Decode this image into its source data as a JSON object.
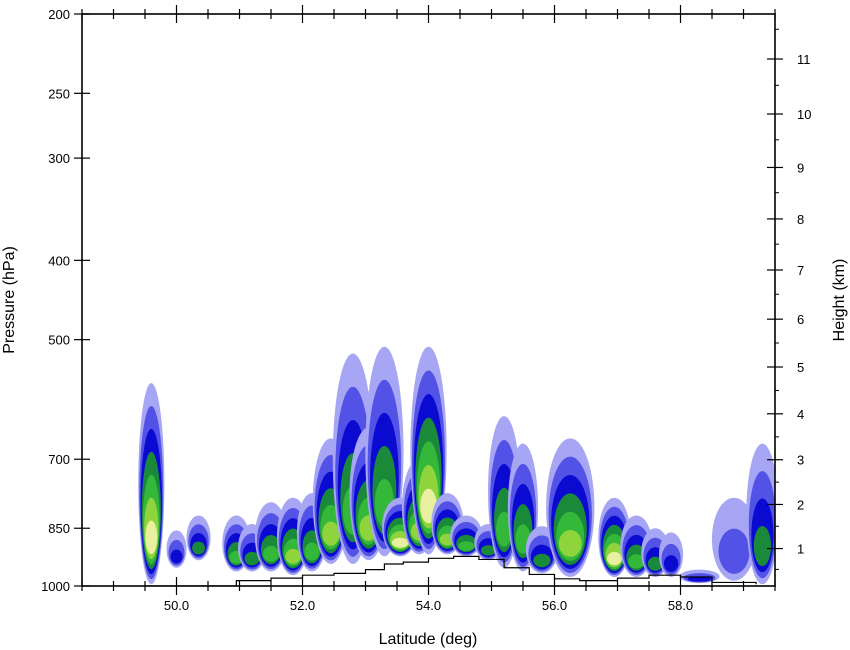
{
  "chart_data": {
    "type": "heatmap",
    "title": "",
    "xlabel": "Latitude (deg)",
    "ylabel_left": "Pressure (hPa)",
    "ylabel_right": "Height (km)",
    "xlim": [
      48.5,
      59.5
    ],
    "x_ticks": [
      {
        "value": 50,
        "label": "50.0"
      },
      {
        "value": 52,
        "label": "52.0"
      },
      {
        "value": 54,
        "label": "54.0"
      },
      {
        "value": 56,
        "label": "56.0"
      },
      {
        "value": 58,
        "label": "58.0"
      }
    ],
    "y_axis_left": {
      "scale": "log",
      "range": [
        1000,
        200
      ],
      "ticks": [
        {
          "value": 1000,
          "label": "1000"
        },
        {
          "value": 850,
          "label": "850"
        },
        {
          "value": 700,
          "label": "700"
        },
        {
          "value": 500,
          "label": "500"
        },
        {
          "value": 400,
          "label": "400"
        },
        {
          "value": 300,
          "label": "300"
        },
        {
          "value": 250,
          "label": "250"
        },
        {
          "value": 200,
          "label": "200"
        }
      ]
    },
    "y_axis_right": {
      "ticks": [
        {
          "value": 1,
          "label": "1",
          "pressure": 900
        },
        {
          "value": 2,
          "label": "2",
          "pressure": 795
        },
        {
          "value": 3,
          "label": "3",
          "pressure": 701
        },
        {
          "value": 4,
          "label": "4",
          "pressure": 616
        },
        {
          "value": 5,
          "label": "5",
          "pressure": 540
        },
        {
          "value": 6,
          "label": "6",
          "pressure": 472
        },
        {
          "value": 7,
          "label": "7",
          "pressure": 411
        },
        {
          "value": 8,
          "label": "8",
          "pressure": 356
        },
        {
          "value": 9,
          "label": "9",
          "pressure": 308
        },
        {
          "value": 10,
          "label": "10",
          "pressure": 265
        },
        {
          "value": 11,
          "label": "11",
          "pressure": 227
        }
      ]
    },
    "color_levels": [
      "#a6a6f4",
      "#5252e6",
      "#0a0ad0",
      "#1a8a3a",
      "#34b83a",
      "#8fd43c",
      "#e8f0a0"
    ],
    "terrain": [
      [
        49.5,
        1000
      ],
      [
        50.9,
        1000
      ],
      [
        50.95,
        985
      ],
      [
        51.5,
        978
      ],
      [
        52.0,
        970
      ],
      [
        52.5,
        965
      ],
      [
        53.0,
        955
      ],
      [
        53.3,
        940
      ],
      [
        53.6,
        935
      ],
      [
        54.0,
        925
      ],
      [
        54.4,
        920
      ],
      [
        54.8,
        928
      ],
      [
        55.2,
        950
      ],
      [
        55.6,
        968
      ],
      [
        56.0,
        980
      ],
      [
        56.4,
        985
      ],
      [
        57.0,
        978
      ],
      [
        57.5,
        970
      ],
      [
        58.0,
        975
      ],
      [
        58.5,
        990
      ],
      [
        59.2,
        995
      ]
    ],
    "cells": [
      {
        "lat": 49.6,
        "p_base": 995,
        "p_top": 565,
        "halfwidth": 0.09,
        "max_level": 6
      },
      {
        "lat": 50.0,
        "p_base": 950,
        "p_top": 855,
        "halfwidth": 0.06,
        "max_level": 2
      },
      {
        "lat": 50.35,
        "p_base": 930,
        "p_top": 820,
        "halfwidth": 0.08,
        "max_level": 3
      },
      {
        "lat": 50.95,
        "p_base": 960,
        "p_top": 820,
        "halfwidth": 0.1,
        "max_level": 4
      },
      {
        "lat": 51.2,
        "p_base": 960,
        "p_top": 840,
        "halfwidth": 0.1,
        "max_level": 3
      },
      {
        "lat": 51.5,
        "p_base": 960,
        "p_top": 790,
        "halfwidth": 0.12,
        "max_level": 4
      },
      {
        "lat": 51.85,
        "p_base": 970,
        "p_top": 780,
        "halfwidth": 0.12,
        "max_level": 5
      },
      {
        "lat": 52.15,
        "p_base": 960,
        "p_top": 770,
        "halfwidth": 0.11,
        "max_level": 4
      },
      {
        "lat": 52.45,
        "p_base": 940,
        "p_top": 660,
        "halfwidth": 0.14,
        "max_level": 5
      },
      {
        "lat": 52.8,
        "p_base": 940,
        "p_top": 520,
        "halfwidth": 0.16,
        "max_level": 4
      },
      {
        "lat": 53.05,
        "p_base": 930,
        "p_top": 640,
        "halfwidth": 0.15,
        "max_level": 5
      },
      {
        "lat": 53.3,
        "p_base": 920,
        "p_top": 510,
        "halfwidth": 0.15,
        "max_level": 4
      },
      {
        "lat": 53.55,
        "p_base": 920,
        "p_top": 780,
        "halfwidth": 0.14,
        "max_level": 6
      },
      {
        "lat": 53.85,
        "p_base": 915,
        "p_top": 700,
        "halfwidth": 0.13,
        "max_level": 5
      },
      {
        "lat": 54.0,
        "p_base": 915,
        "p_top": 510,
        "halfwidth": 0.14,
        "max_level": 6
      },
      {
        "lat": 54.3,
        "p_base": 915,
        "p_top": 770,
        "halfwidth": 0.12,
        "max_level": 5
      },
      {
        "lat": 54.6,
        "p_base": 920,
        "p_top": 820,
        "halfwidth": 0.12,
        "max_level": 4
      },
      {
        "lat": 54.95,
        "p_base": 930,
        "p_top": 840,
        "halfwidth": 0.1,
        "max_level": 3
      },
      {
        "lat": 55.2,
        "p_base": 950,
        "p_top": 620,
        "halfwidth": 0.12,
        "max_level": 4
      },
      {
        "lat": 55.5,
        "p_base": 960,
        "p_top": 670,
        "halfwidth": 0.11,
        "max_level": 4
      },
      {
        "lat": 55.8,
        "p_base": 965,
        "p_top": 845,
        "halfwidth": 0.12,
        "max_level": 3
      },
      {
        "lat": 56.25,
        "p_base": 975,
        "p_top": 660,
        "halfwidth": 0.2,
        "max_level": 5
      },
      {
        "lat": 56.95,
        "p_base": 975,
        "p_top": 780,
        "halfwidth": 0.12,
        "max_level": 6
      },
      {
        "lat": 57.3,
        "p_base": 975,
        "p_top": 820,
        "halfwidth": 0.12,
        "max_level": 4
      },
      {
        "lat": 57.6,
        "p_base": 975,
        "p_top": 850,
        "halfwidth": 0.1,
        "max_level": 3
      },
      {
        "lat": 57.85,
        "p_base": 975,
        "p_top": 860,
        "halfwidth": 0.08,
        "max_level": 2
      },
      {
        "lat": 58.3,
        "p_base": 992,
        "p_top": 955,
        "halfwidth": 0.16,
        "max_level": 2
      },
      {
        "lat": 58.85,
        "p_base": 985,
        "p_top": 780,
        "halfwidth": 0.18,
        "max_level": 1
      },
      {
        "lat": 59.3,
        "p_base": 995,
        "p_top": 670,
        "halfwidth": 0.12,
        "max_level": 3
      }
    ]
  }
}
